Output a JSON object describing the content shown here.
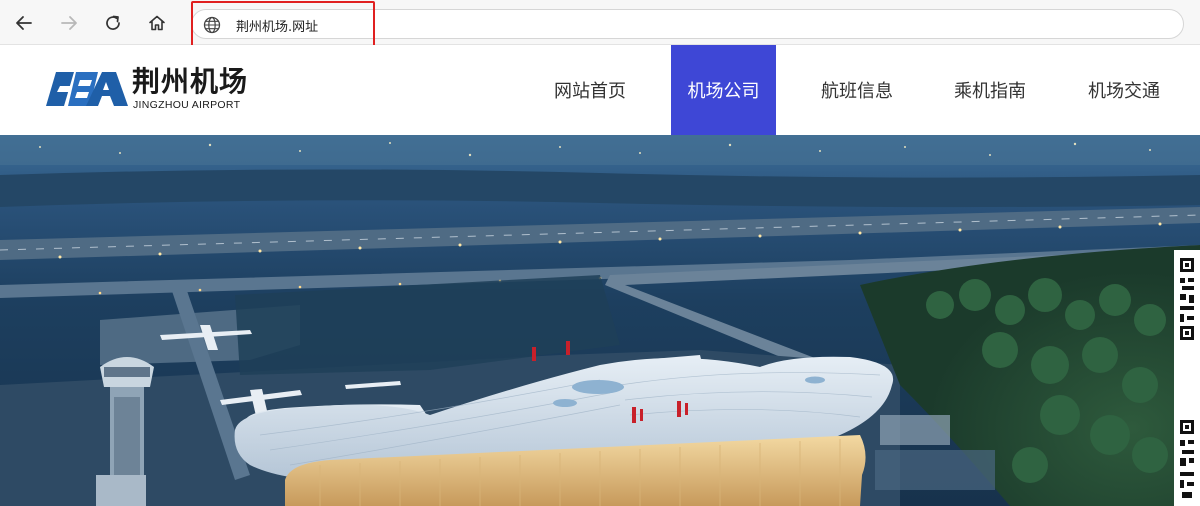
{
  "browser": {
    "url": "荆州机场.网址",
    "icons": [
      "back-arrow-icon",
      "forward-arrow-icon",
      "refresh-icon",
      "home-icon",
      "globe-icon"
    ]
  },
  "site": {
    "logo": {
      "cn": "荆州机场",
      "en": "JINGZHOU AIRPORT"
    },
    "nav": [
      {
        "label": "网站首页",
        "active": false
      },
      {
        "label": "机场公司",
        "active": true
      },
      {
        "label": "航班信息",
        "active": false
      },
      {
        "label": "乘机指南",
        "active": false
      },
      {
        "label": "机场交通",
        "active": false
      }
    ]
  },
  "colors": {
    "nav_active_bg": "#3e47d6",
    "highlight_border": "#e02020",
    "logo_blue": "#1f5fa8"
  }
}
